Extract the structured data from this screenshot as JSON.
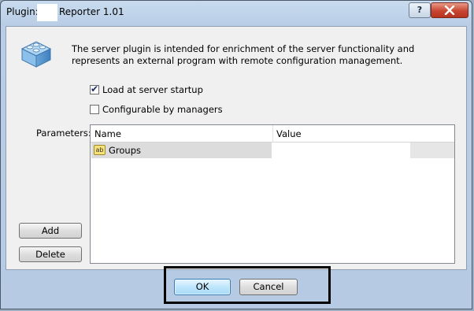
{
  "window": {
    "title_label": "Plugin:",
    "title_name": "Reporter 1.01",
    "help_label": "?"
  },
  "description": "The server plugin is intended for enrichment of the server functionality and represents an external program with remote configuration management.",
  "options": {
    "load_at_startup": {
      "label": "Load at server startup",
      "checked": true
    },
    "configurable_by_managers": {
      "label": "Configurable by managers",
      "checked": false
    }
  },
  "parameters": {
    "label": "Parameters:",
    "columns": [
      "Name",
      "Value"
    ],
    "rows": [
      {
        "icon": "string-param-icon",
        "icon_text": "ab",
        "name": "Groups",
        "value": ""
      }
    ],
    "add_label": "Add",
    "delete_label": "Delete"
  },
  "footer": {
    "ok_label": "OK",
    "cancel_label": "Cancel"
  }
}
